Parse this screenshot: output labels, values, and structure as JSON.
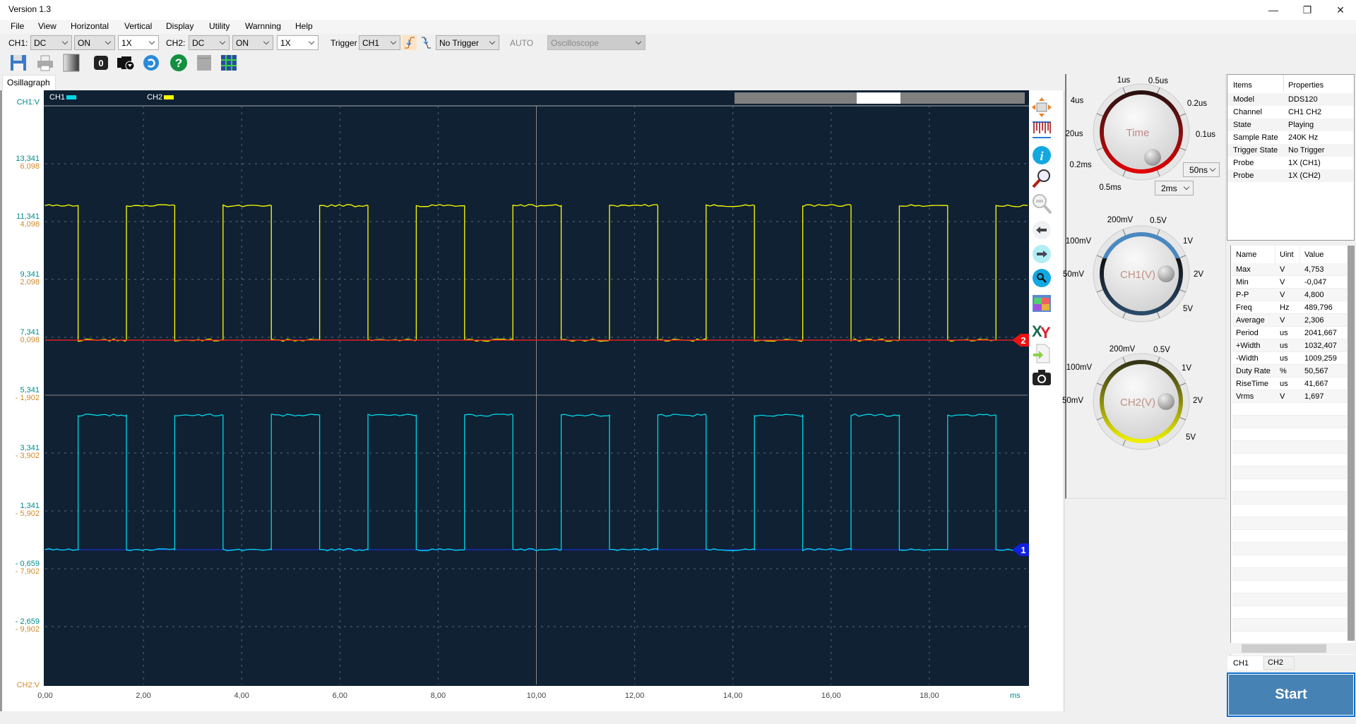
{
  "window": {
    "title": "Version 1.3",
    "minimize": "—",
    "restore": "❐",
    "close": "✕"
  },
  "menu": [
    "File",
    "View",
    "Horizontal",
    "Vertical",
    "Display",
    "Utility",
    "Warnning",
    "Help"
  ],
  "toolbar": {
    "ch1_label": "CH1:",
    "ch1_coupling": "DC",
    "ch1_state": "ON",
    "ch1_probe": "1X",
    "ch2_label": "CH2:",
    "ch2_coupling": "DC",
    "ch2_state": "ON",
    "ch2_probe": "1X",
    "trigger_label": "Trigger",
    "trigger_source": "CH1",
    "trigger_mode": "No Trigger",
    "auto_label": "AUTO",
    "mode": "Oscilloscope"
  },
  "toolbar2_icons": [
    "save-icon",
    "print-icon",
    "gradient-icon",
    "zero-icon",
    "record-icon",
    "refresh-icon",
    "help-icon",
    "panel-icon",
    "grid-icon"
  ],
  "tab": "Osillagraph",
  "plot": {
    "ch1_axis_label": "CH1:V",
    "ch2_axis_label": "CH2:V",
    "legend": [
      {
        "name": "CH1",
        "color": "#00d8e8"
      },
      {
        "name": "CH2",
        "color": "#ffff00"
      }
    ],
    "ch1_ticks": [
      "13,341",
      "11,341",
      "9,341",
      "7,341",
      "5,341",
      "3,341",
      "1,341",
      "- 0,659",
      "- 2,659"
    ],
    "ch2_ticks": [
      "6,098",
      "4,098",
      "2,098",
      "0,098",
      "- 1,902",
      "- 3,902",
      "- 5,902",
      "- 7,902",
      "- 9,902"
    ],
    "x_ticks": [
      "0,00",
      "2,00",
      "4,00",
      "6,00",
      "8,00",
      "10,00",
      "12,00",
      "14,00",
      "16,00",
      "18,00"
    ],
    "x_unit": "ms",
    "x_range_ms": [
      0,
      20
    ],
    "volts_per_div": 2,
    "background": "#0f2133",
    "ch1_marker": "1",
    "ch2_marker": "2",
    "waveform": {
      "period_ms": 1.967,
      "first_edge_ms": 0.67,
      "high_v": 4.65,
      "low_v": 0,
      "ch1_starts": "low",
      "ch2_starts": "high"
    }
  },
  "side_icons": [
    "auto-fit-icon",
    "measure-ruler-icon",
    "info-icon",
    "zoom-in-icon",
    "zoom-out-icon",
    "back-arrow-icon",
    "forward-arrow-icon",
    "search-icon",
    "color-palette-icon",
    "xy-mode-icon",
    "export-icon",
    "camera-icon"
  ],
  "knobs": {
    "time": {
      "title": "Time",
      "labels": [
        "1us",
        "0.5us",
        "4us",
        "0.2us",
        "20us",
        "0.1us",
        "0.2ms",
        "0.5ms"
      ],
      "fine": "50ns",
      "value": "2ms"
    },
    "ch1": {
      "title": "CH1(V)",
      "labels": [
        "200mV",
        "0.5V",
        "100mV",
        "1V",
        "50mV",
        "2V",
        "5V"
      ]
    },
    "ch2": {
      "title": "CH2(V)",
      "labels": [
        "200mV",
        "0.5V",
        "100mV",
        "1V",
        "50mV",
        "2V",
        "5V"
      ]
    }
  },
  "properties": {
    "headers": [
      "Items",
      "Properties"
    ],
    "rows": [
      [
        "Model",
        "DDS120"
      ],
      [
        "Channel",
        "CH1 CH2"
      ],
      [
        "State",
        "Playing"
      ],
      [
        "Sample Rate",
        "240K Hz"
      ],
      [
        "Trigger State",
        "No Trigger"
      ],
      [
        "Probe",
        "1X (CH1)"
      ],
      [
        "Probe",
        "1X (CH2)"
      ]
    ]
  },
  "measurements": {
    "headers": [
      "Name",
      "Uint",
      "Value"
    ],
    "rows": [
      [
        "Max",
        "V",
        "4,753"
      ],
      [
        "Min",
        "V",
        "-0,047"
      ],
      [
        "P-P",
        "V",
        "4,800"
      ],
      [
        "Freq",
        "Hz",
        "489,796"
      ],
      [
        "Average",
        "V",
        "2,306"
      ],
      [
        "Period",
        "us",
        "2041,667"
      ],
      [
        "+Width",
        "us",
        "1032,407"
      ],
      [
        "-Width",
        "us",
        "1009,259"
      ],
      [
        "Duty Rate",
        "%",
        "50,567"
      ],
      [
        "RiseTime",
        "us",
        "41,667"
      ],
      [
        "Vrms",
        "V",
        "1,697"
      ]
    ]
  },
  "bottom_tabs": [
    "CH1",
    "CH2"
  ],
  "start_label": "Start"
}
